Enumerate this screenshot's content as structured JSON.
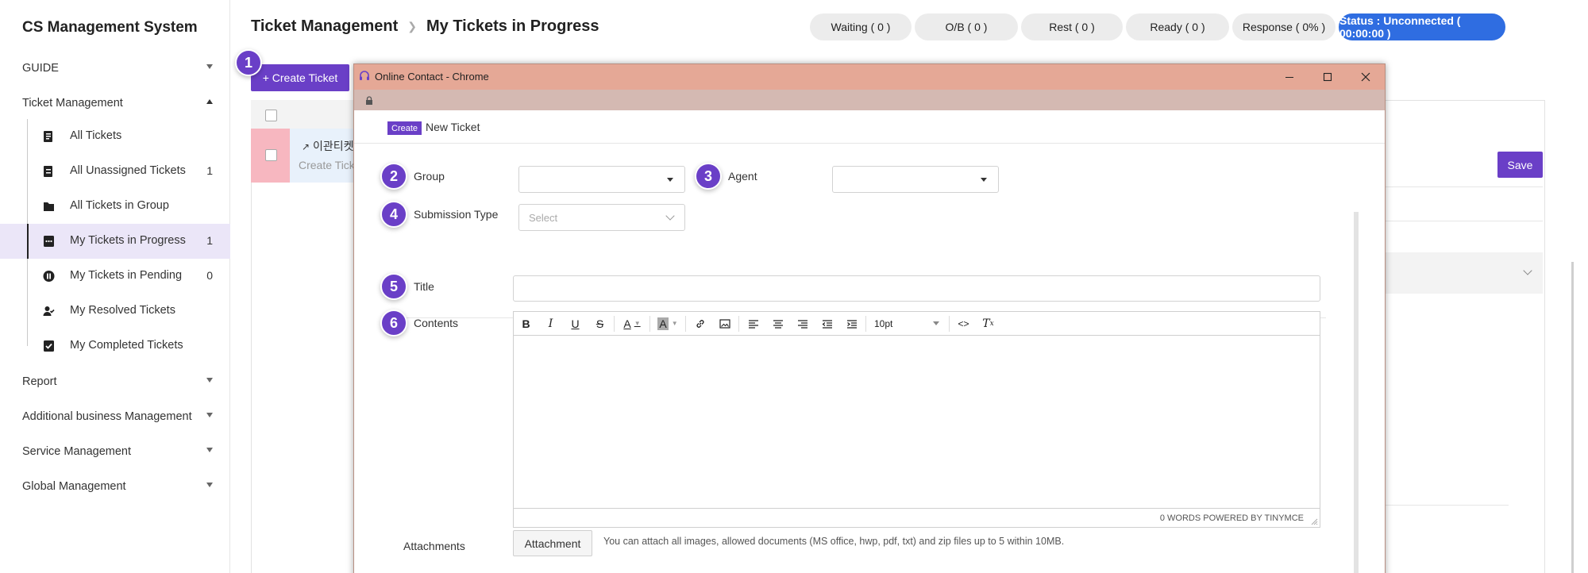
{
  "sidebar": {
    "brand": "CS Management System",
    "guide": "GUIDE",
    "ticket_management": "Ticket Management",
    "items": [
      {
        "label": "All Tickets",
        "count": ""
      },
      {
        "label": "All Unassigned Tickets",
        "count": "1"
      },
      {
        "label": "All Tickets in Group",
        "count": ""
      },
      {
        "label": "My Tickets in Progress",
        "count": "1"
      },
      {
        "label": "My Tickets in Pending",
        "count": "0"
      },
      {
        "label": "My Resolved Tickets",
        "count": ""
      },
      {
        "label": "My Completed Tickets",
        "count": ""
      }
    ],
    "report": "Report",
    "additional": "Additional business Management",
    "service": "Service Management",
    "global": "Global Management"
  },
  "header": {
    "breadcrumb_root": "Ticket Management",
    "breadcrumb_current": "My Tickets in Progress",
    "status": {
      "waiting": "Waiting ( 0 )",
      "ob": "O/B ( 0 )",
      "rest": "Rest ( 0 )",
      "ready": "Ready ( 0 )",
      "response": "Response ( 0% )",
      "connection": "Status : Unconnected ( 00:00:00 )"
    }
  },
  "page": {
    "create_ticket_label": "+ Create Ticket",
    "save_label": "Save",
    "ticket_name": "이관티켓",
    "ticket_sub": "Create Tick"
  },
  "popup": {
    "window_title": "Online Contact - Chrome",
    "create_tag": "Create",
    "heading": "New Ticket",
    "fields": {
      "group": "Group",
      "agent": "Agent",
      "submission_type": "Submission Type",
      "submission_placeholder": "Select",
      "title": "Title",
      "contents": "Contents",
      "attachments": "Attachments"
    },
    "editor": {
      "font_size": "10pt",
      "status": "0 WORDS POWERED BY TINYMCE"
    },
    "attachment_button": "Attachment",
    "attachment_hint": "You can attach all images, allowed documents (MS office, hwp, pdf, txt) and zip files up to 5 within 10MB."
  },
  "badges": [
    "1",
    "2",
    "3",
    "4",
    "5",
    "6"
  ],
  "colors": {
    "accent": "#6a3fc7",
    "titlebar": "#e5a896",
    "status_blue": "#2f6de1",
    "active_item_bg": "#ebe6f8"
  }
}
